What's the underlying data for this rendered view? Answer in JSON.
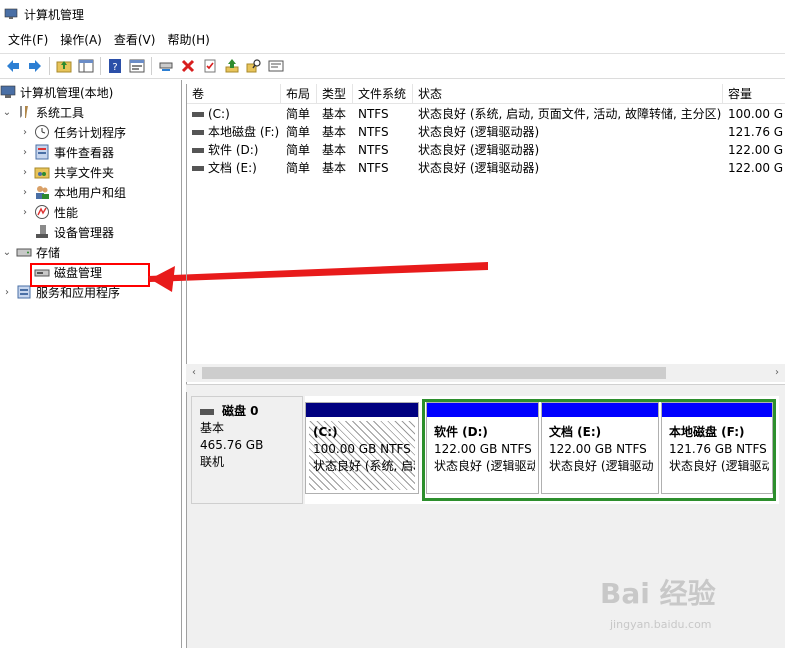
{
  "window": {
    "title": "计算机管理"
  },
  "menu": [
    "文件(F)",
    "操作(A)",
    "查看(V)",
    "帮助(H)"
  ],
  "toolbar": {
    "icons": [
      "back-arrow-icon",
      "forward-arrow-icon",
      "up-folder-icon",
      "show-hide-tree-icon",
      "help-icon",
      "properties-icon",
      "connect-disk-icon",
      "delete-icon",
      "check-icon",
      "upload-icon",
      "search-icon",
      "format-icon"
    ]
  },
  "tree": {
    "root": "计算机管理(本地)",
    "system_tools": "系统工具",
    "task_scheduler": "任务计划程序",
    "event_viewer": "事件查看器",
    "shared_folders": "共享文件夹",
    "local_users": "本地用户和组",
    "performance": "性能",
    "device_manager": "设备管理器",
    "storage": "存储",
    "disk_management": "磁盘管理",
    "services_apps": "服务和应用程序"
  },
  "volumes": {
    "headers": [
      "卷",
      "布局",
      "类型",
      "文件系统",
      "状态",
      "容量"
    ],
    "rows": [
      [
        "(C:)",
        "简单",
        "基本",
        "NTFS",
        "状态良好 (系统, 启动, 页面文件, 活动, 故障转储, 主分区)",
        "100.00 G"
      ],
      [
        "本地磁盘 (F:)",
        "简单",
        "基本",
        "NTFS",
        "状态良好 (逻辑驱动器)",
        "121.76 G"
      ],
      [
        "软件 (D:)",
        "简单",
        "基本",
        "NTFS",
        "状态良好 (逻辑驱动器)",
        "122.00 G"
      ],
      [
        "文档 (E:)",
        "简单",
        "基本",
        "NTFS",
        "状态良好 (逻辑驱动器)",
        "122.00 G"
      ]
    ]
  },
  "disk0": {
    "name": "磁盘 0",
    "type": "基本",
    "size": "465.76 GB",
    "status": "联机",
    "partitions": [
      {
        "name": "(C:)",
        "size": "100.00 GB NTFS",
        "status": "状态良好 (系统, 启动",
        "bar_color": "#000080"
      },
      {
        "name": "软件 (D:)",
        "size": "122.00 GB NTFS",
        "status": "状态良好 (逻辑驱动",
        "bar_color": "#0000ff"
      },
      {
        "name": "文档 (E:)",
        "size": "122.00 GB NTFS",
        "status": "状态良好 (逻辑驱动",
        "bar_color": "#0000ff"
      },
      {
        "name": "本地磁盘 (F:)",
        "size": "121.76 GB NTFS",
        "status": "状态良好 (逻辑驱动",
        "bar_color": "#0000ff"
      }
    ]
  },
  "watermark": {
    "brand": "Bai 经验",
    "url": "jingyan.baidu.com"
  },
  "colors": {
    "highlight": "#ff0000",
    "extended_partition": "#2d8f2d"
  }
}
